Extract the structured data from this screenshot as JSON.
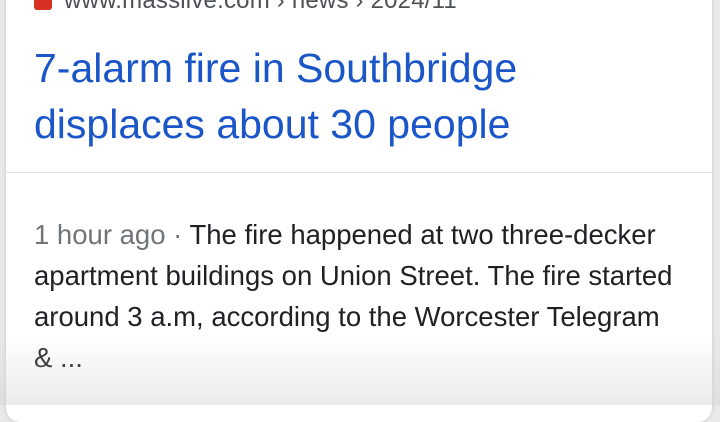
{
  "result": {
    "source_url": "www.masslive.com › news › 2024/11",
    "favicon": "masslive-favicon",
    "headline": "7-alarm fire in Southbridge displaces about 30 people",
    "snippet_time": "1 hour ago",
    "snippet_separator": " · ",
    "snippet_text": "The fire happened at two three-decker apartment buildings on Union Street. The fire started around 3 a.m, according to the Worcester Telegram & ...",
    "colors": {
      "headline": "#1a56c8",
      "snippet": "#202124",
      "meta": "#70757a",
      "favicon": "#d93025"
    }
  }
}
